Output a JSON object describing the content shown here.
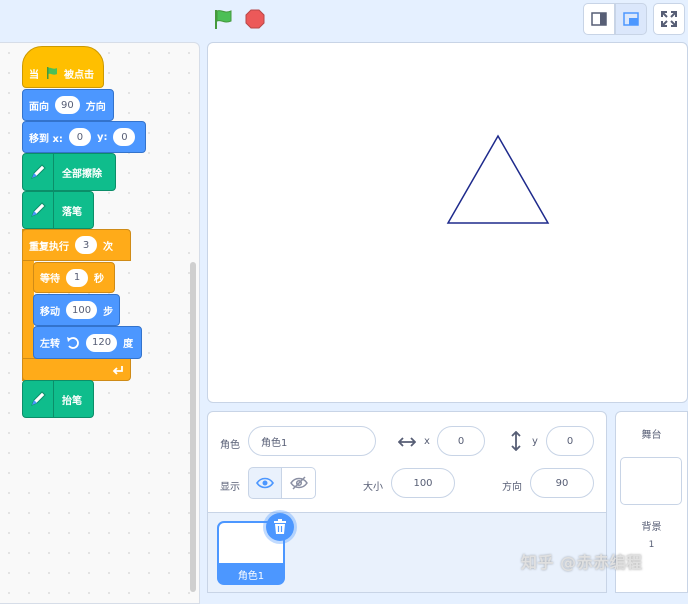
{
  "toolbar": {
    "green_flag_icon": "green-flag",
    "stop_icon": "stop-sign",
    "small_stage_icon": "small-stage-mode",
    "normal_stage_icon": "normal-stage-mode",
    "fullscreen_icon": "fullscreen",
    "flag_color": "#4cbf56",
    "stop_color": "#ec5959"
  },
  "script": {
    "hat": {
      "prefix": "当",
      "suffix": "被点击"
    },
    "point": {
      "label": "面向",
      "value": "90",
      "suffix": "方向"
    },
    "goto": {
      "label": "移到 x:",
      "x": "0",
      "ylabel": "y:",
      "y": "0"
    },
    "erase": {
      "label": "全部擦除"
    },
    "pendown": {
      "label": "落笔"
    },
    "repeat": {
      "label": "重复执行",
      "value": "3",
      "suffix": "次"
    },
    "wait": {
      "label": "等待",
      "value": "1",
      "suffix": "秒"
    },
    "move": {
      "label": "移动",
      "value": "100",
      "suffix": "步"
    },
    "turn": {
      "label": "左转",
      "value": "120",
      "suffix": "度"
    },
    "penup": {
      "label": "抬笔"
    }
  },
  "colors": {
    "events": "#ffbf00",
    "motion": "#4c97ff",
    "pen": "#0fbd8c",
    "control": "#ffab19"
  },
  "sprite_info": {
    "sprite_label": "角色",
    "sprite_name": "角色1",
    "x_label": "x",
    "x_value": "0",
    "y_label": "y",
    "y_value": "0",
    "show_label": "显示",
    "size_label": "大小",
    "size_value": "100",
    "direction_label": "方向",
    "direction_value": "90"
  },
  "sprite_list": {
    "items": [
      {
        "name": "角色1"
      }
    ]
  },
  "stage_panel": {
    "title": "舞台",
    "backdrop_label": "背景",
    "backdrop_count": "1"
  },
  "watermark": "知乎 @赤赤编程"
}
